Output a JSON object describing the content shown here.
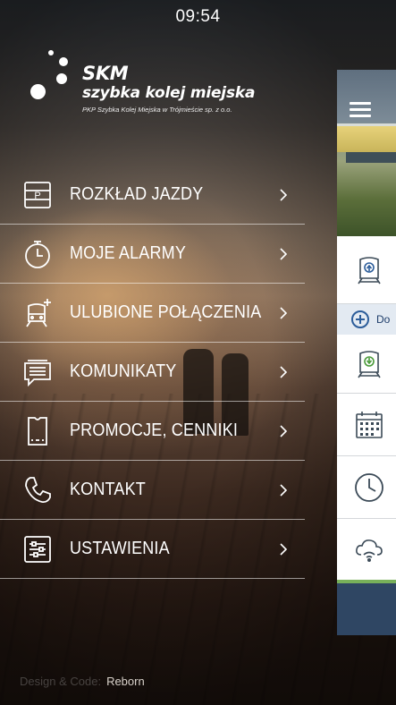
{
  "status": {
    "time": "09:54"
  },
  "logo": {
    "title": "SKM",
    "subtitle": "szybka kolej miejska",
    "caption": "PKP Szybka Kolej Miejska w Trójmieście sp. z o.o."
  },
  "menu": {
    "items": [
      {
        "label": "ROZKŁAD JAZDY",
        "icon": "timetable-icon"
      },
      {
        "label": "MOJE ALARMY",
        "icon": "alarm-clock-icon"
      },
      {
        "label": "ULUBIONE POŁĄCZENIA",
        "icon": "favorite-train-icon"
      },
      {
        "label": "KOMUNIKATY",
        "icon": "messages-icon"
      },
      {
        "label": "PROMOCJE, CENNIKI",
        "icon": "ticket-icon"
      },
      {
        "label": "KONTAKT",
        "icon": "phone-icon"
      },
      {
        "label": "USTAWIENIA",
        "icon": "settings-sliders-icon"
      }
    ]
  },
  "footer": {
    "design_label": "Design & Code:",
    "author": "Reborn"
  },
  "background_panel": {
    "add_label": "Do"
  },
  "colors": {
    "accent_blue": "#2c5d9a",
    "accent_green": "#78b05a",
    "panel_dark": "#2f4663"
  }
}
